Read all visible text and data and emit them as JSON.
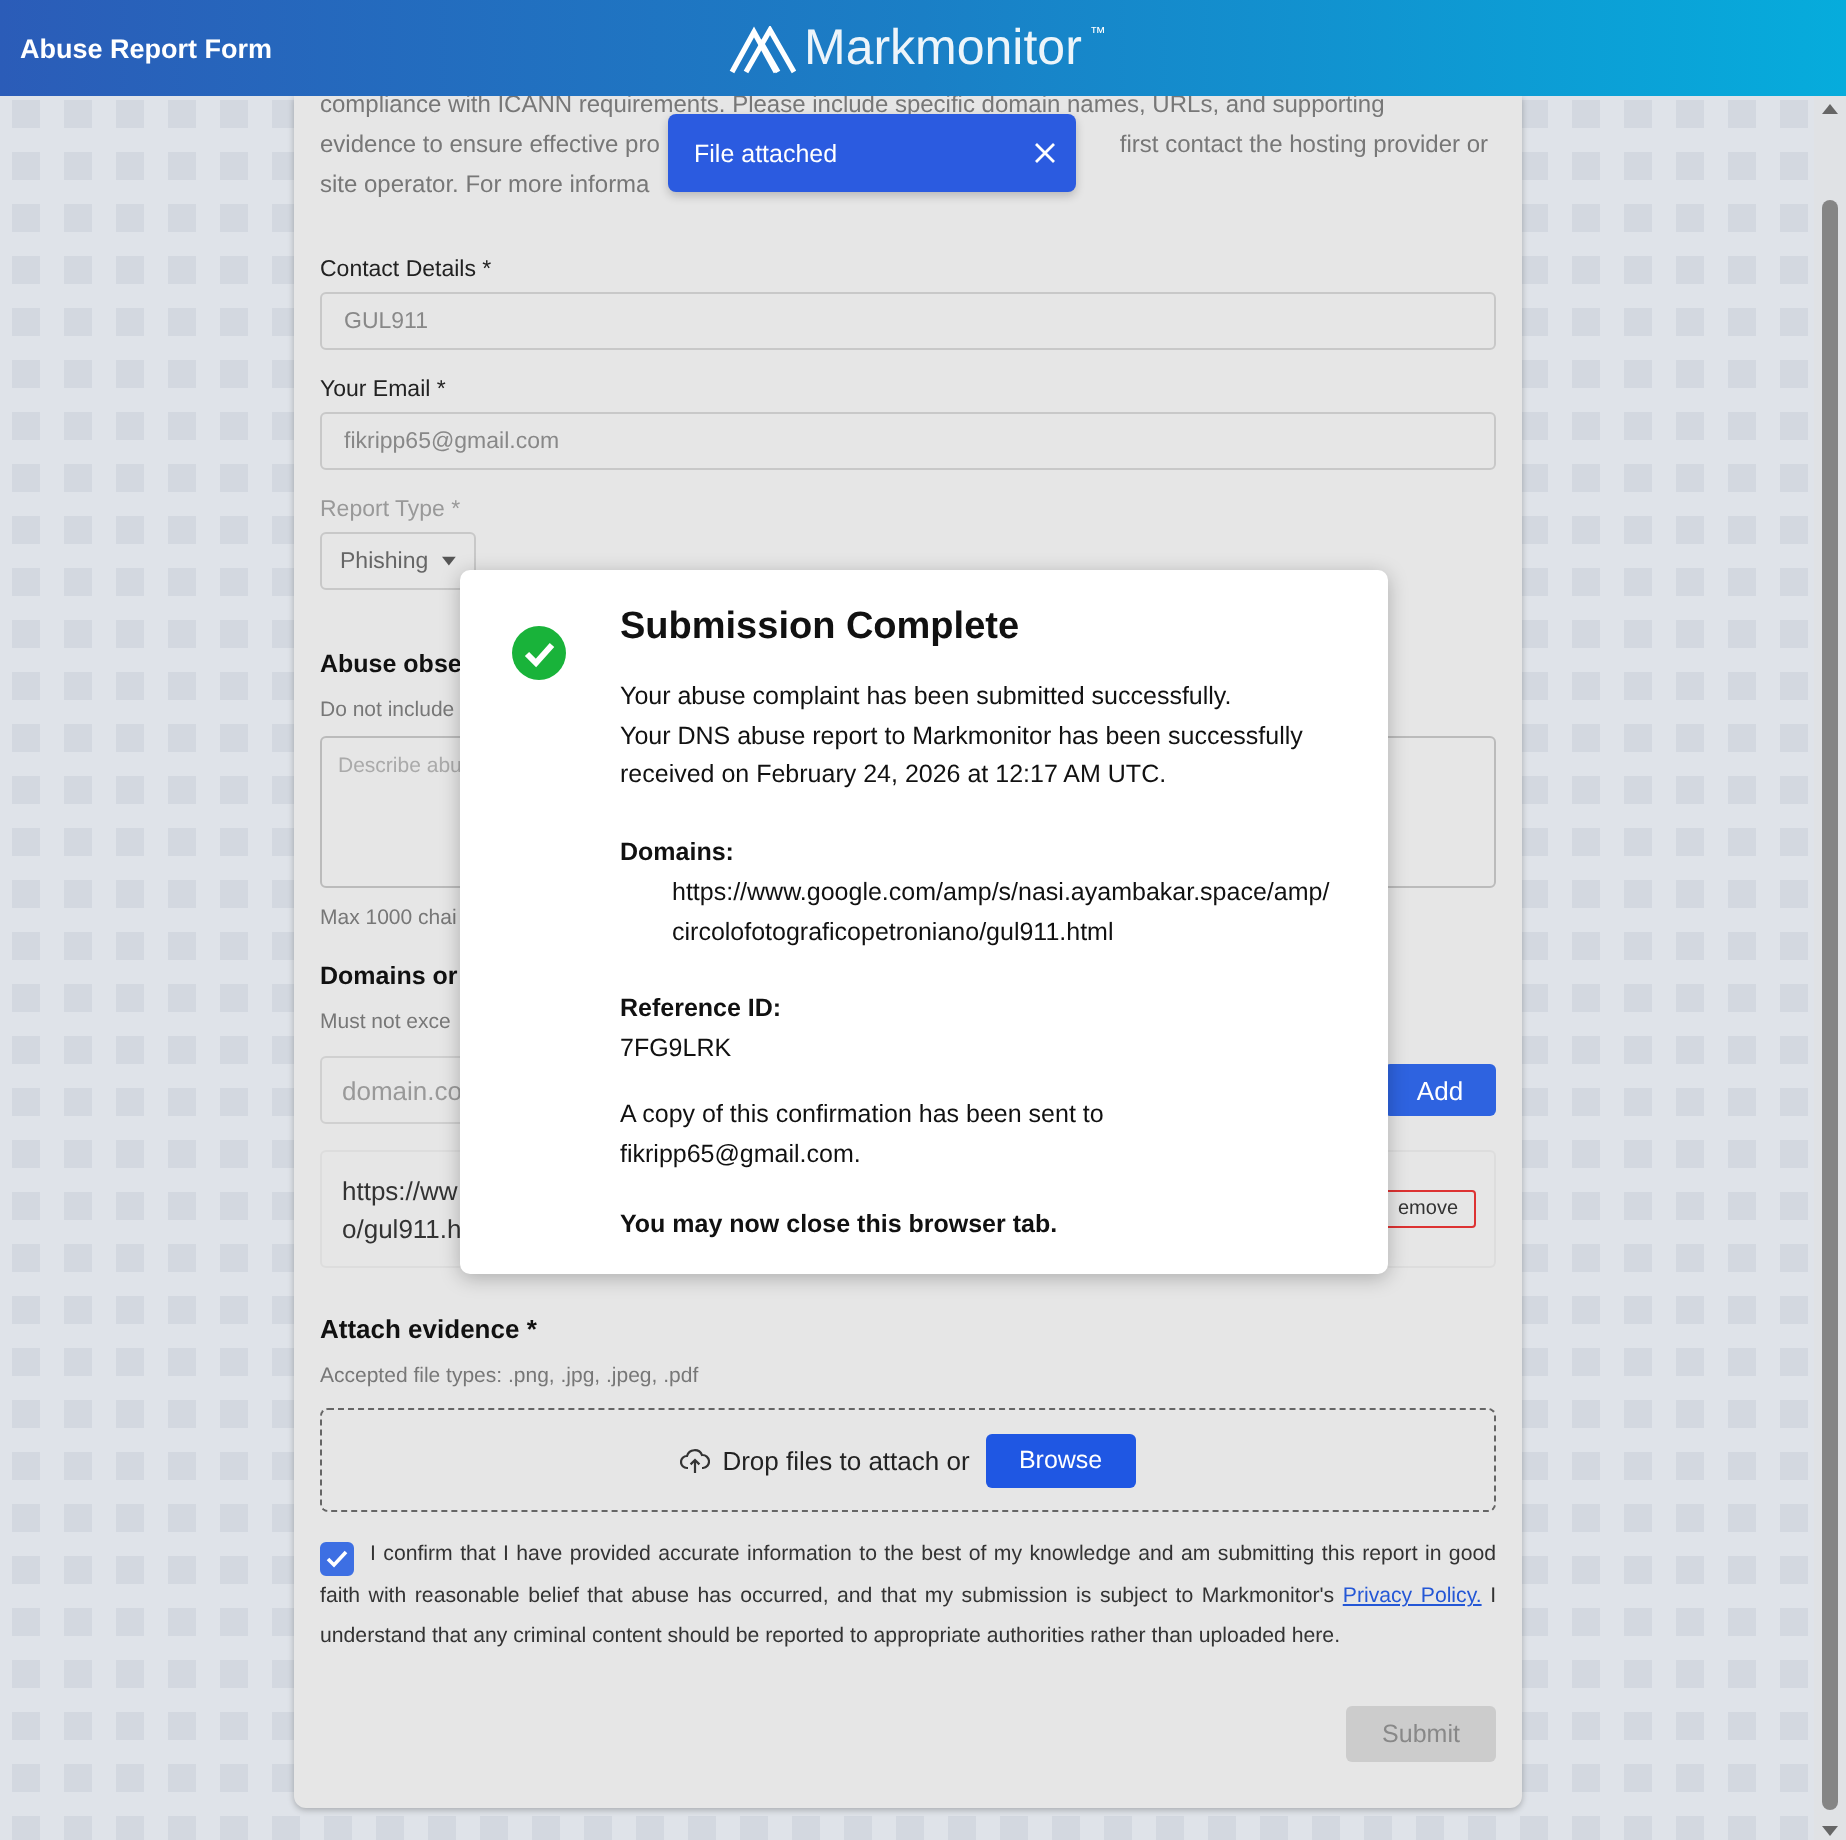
{
  "header": {
    "title": "Abuse Report Form",
    "logo_text": "Markmonitor",
    "logo_mark": "™"
  },
  "toast": {
    "message": "File attached"
  },
  "form": {
    "intro_lines": [
      [
        "compliance with ICANN requirements. Please include specific domain names, URLs, and supporting"
      ],
      [
        "evidence to ensure effective pro",
        "first contact the hosting provider or"
      ],
      [
        "site operator. For more informa"
      ]
    ],
    "fields": [
      {
        "kind": "input",
        "label": "Contact Details *",
        "value": "GUL911",
        "disabled": false
      },
      {
        "kind": "input",
        "label": "Your Email *",
        "value": "fikripp65@gmail.com",
        "disabled": false
      },
      {
        "kind": "select",
        "label": "Report Type *",
        "value": "Phishing",
        "disabled": true
      }
    ],
    "abuse_section": {
      "heading": "Abuse obse",
      "hint": "Do not include",
      "placeholder": "Describe abu",
      "counter": "Max 1000 chai"
    },
    "domains_section": {
      "heading": "Domains or",
      "hint": "Must not exce",
      "placeholder": "domain.co",
      "add_button": "Add",
      "items": [
        {
          "lines": [
            "https://ww",
            "o/gul911.h"
          ],
          "remove_button": "emove"
        }
      ]
    },
    "evidence": {
      "heading": "Attach evidence *",
      "hint": "Accepted file types: .png, .jpg, .jpeg, .pdf",
      "drop_text": "Drop files to attach or",
      "browse_button": "Browse"
    },
    "consent": {
      "checked": true,
      "text": "I confirm that I have provided accurate information to the best of my knowledge and am submitting this report in good faith with reasonable belief that abuse has occurred, and that my submission is subject to Markmonitor's",
      "link": "Privacy Policy.",
      "text_after": "I understand that any criminal content should be reported to appropriate authorities rather than uploaded here."
    },
    "submit": {
      "label": "Submit",
      "disabled": true
    }
  },
  "modal": {
    "title": "Submission Complete",
    "lines": [
      "Your abuse complaint has been submitted successfully.",
      "Your DNS abuse report to Markmonitor has been successfully received on February 24, 2026 at 12:17 AM UTC."
    ],
    "domains_label": "Domains:",
    "domains": [
      "https://www.google.com/amp/s/nasi.ayambakar.space/amp/circolofotograficopetroniano/gul911.html"
    ],
    "reference_label": "Reference ID:",
    "reference_id": "7FG9LRK",
    "copy_note": "A copy of this confirmation has been sent to fikripp65@gmail.com.",
    "closing": "You may now close this browser tab."
  }
}
